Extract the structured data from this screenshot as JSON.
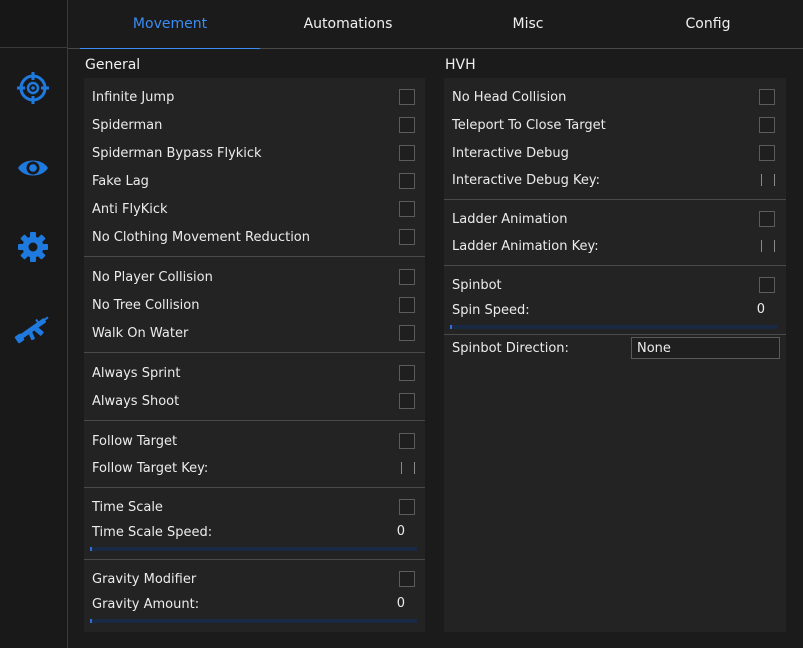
{
  "tabs": [
    {
      "label": "Movement",
      "active": true
    },
    {
      "label": "Automations",
      "active": false
    },
    {
      "label": "Misc",
      "active": false
    },
    {
      "label": "Config",
      "active": false
    }
  ],
  "sidebar": {
    "icons": [
      "crosshair-icon",
      "eye-icon",
      "gear-icon",
      "rifle-icon"
    ],
    "accent": "#1f7ae0"
  },
  "general": {
    "title": "General",
    "infinite_jump": "Infinite Jump",
    "spiderman": "Spiderman",
    "spiderman_bypass": "Spiderman Bypass Flykick",
    "fake_lag": "Fake Lag",
    "anti_flykick": "Anti FlyKick",
    "no_clothing": "No Clothing Movement Reduction",
    "no_player_collision": "No Player Collision",
    "no_tree_collision": "No Tree Collision",
    "walk_on_water": "Walk On Water",
    "always_sprint": "Always Sprint",
    "always_shoot": "Always Shoot",
    "follow_target": "Follow Target",
    "follow_target_key": "Follow Target Key:",
    "time_scale": "Time Scale",
    "time_scale_speed": "Time Scale Speed:",
    "time_scale_value": "0",
    "gravity_modifier": "Gravity Modifier",
    "gravity_amount": "Gravity Amount:",
    "gravity_value": "0"
  },
  "hvh": {
    "title": "HVH",
    "no_head_collision": "No Head Collision",
    "teleport": "Teleport To Close Target",
    "interactive_debug": "Interactive Debug",
    "interactive_debug_key": "Interactive Debug Key:",
    "ladder_animation": "Ladder Animation",
    "ladder_animation_key": "Ladder Animation Key:",
    "spinbot": "Spinbot",
    "spin_speed": "Spin Speed:",
    "spin_speed_value": "0",
    "spinbot_direction": "Spinbot Direction:",
    "spinbot_direction_value": "None"
  },
  "colors": {
    "accent": "#3a8df5",
    "background": "#1b1b1b",
    "panel": "#232323"
  }
}
